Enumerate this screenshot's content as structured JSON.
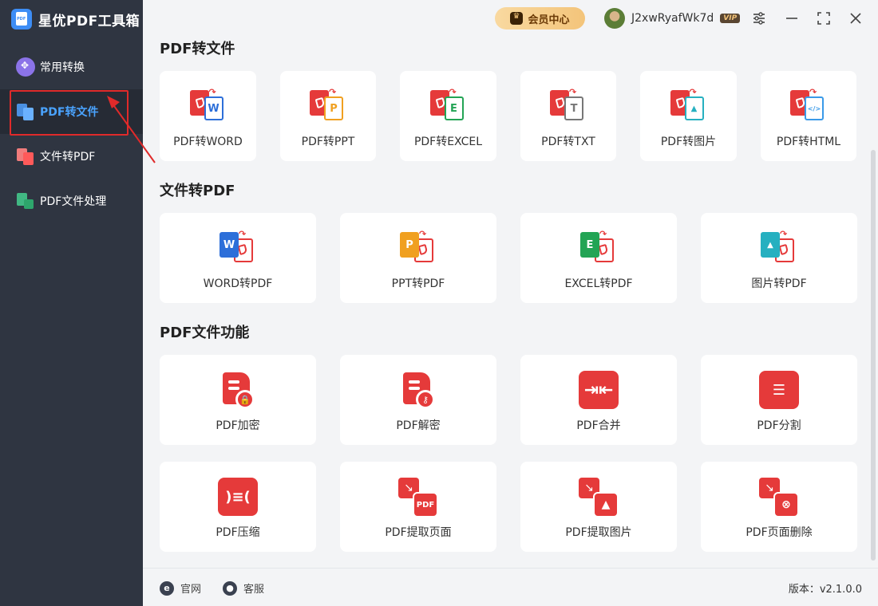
{
  "app": {
    "title": "星优PDF工具箱"
  },
  "sidebar": {
    "items": [
      {
        "label": "常用转换",
        "icon": "grid-icon"
      },
      {
        "label": "PDF转文件",
        "icon": "pdf-to-file-icon"
      },
      {
        "label": "文件转PDF",
        "icon": "file-to-pdf-icon"
      },
      {
        "label": "PDF文件处理",
        "icon": "pdf-process-icon"
      }
    ]
  },
  "header": {
    "vip_center": "会员中心",
    "username": "J2xwRyafWk7d",
    "vip_badge": "VIP"
  },
  "sections": {
    "pdf_to_file": {
      "title": "PDF转文件",
      "items": [
        {
          "label": "PDF转WORD",
          "letter": "W",
          "color": "#2d6fd9"
        },
        {
          "label": "PDF转PPT",
          "letter": "P",
          "color": "#f0a020"
        },
        {
          "label": "PDF转EXCEL",
          "letter": "E",
          "color": "#23a455"
        },
        {
          "label": "PDF转TXT",
          "letter": "T",
          "color": "#777777"
        },
        {
          "label": "PDF转图片",
          "letter": "▲",
          "color": "#26b0c0"
        },
        {
          "label": "PDF转HTML",
          "letter": "</>",
          "color": "#3a9ae8"
        }
      ]
    },
    "file_to_pdf": {
      "title": "文件转PDF",
      "items": [
        {
          "label": "WORD转PDF",
          "letter": "W",
          "color": "#2d6fd9"
        },
        {
          "label": "PPT转PDF",
          "letter": "P",
          "color": "#f0a020"
        },
        {
          "label": "EXCEL转PDF",
          "letter": "E",
          "color": "#23a455"
        },
        {
          "label": "图片转PDF",
          "letter": "▲",
          "color": "#26b0c0"
        }
      ]
    },
    "pdf_functions": {
      "title": "PDF文件功能",
      "items": [
        {
          "label": "PDF加密",
          "icon": "lock-icon"
        },
        {
          "label": "PDF解密",
          "icon": "key-icon"
        },
        {
          "label": "PDF合并",
          "icon": "merge-icon"
        },
        {
          "label": "PDF分割",
          "icon": "split-icon"
        },
        {
          "label": "PDF压缩",
          "icon": "compress-icon"
        },
        {
          "label": "PDF提取页面",
          "icon": "extract-page-icon"
        },
        {
          "label": "PDF提取图片",
          "icon": "extract-image-icon"
        },
        {
          "label": "PDF页面删除",
          "icon": "delete-page-icon"
        }
      ]
    }
  },
  "footer": {
    "website": "官网",
    "support": "客服",
    "version": "版本：v2.1.0.0"
  },
  "colors": {
    "accent": "#4aa3ff",
    "sidebar_bg": "#2f3541",
    "brand_red": "#e53a3a",
    "highlight": "#e02a2a"
  }
}
